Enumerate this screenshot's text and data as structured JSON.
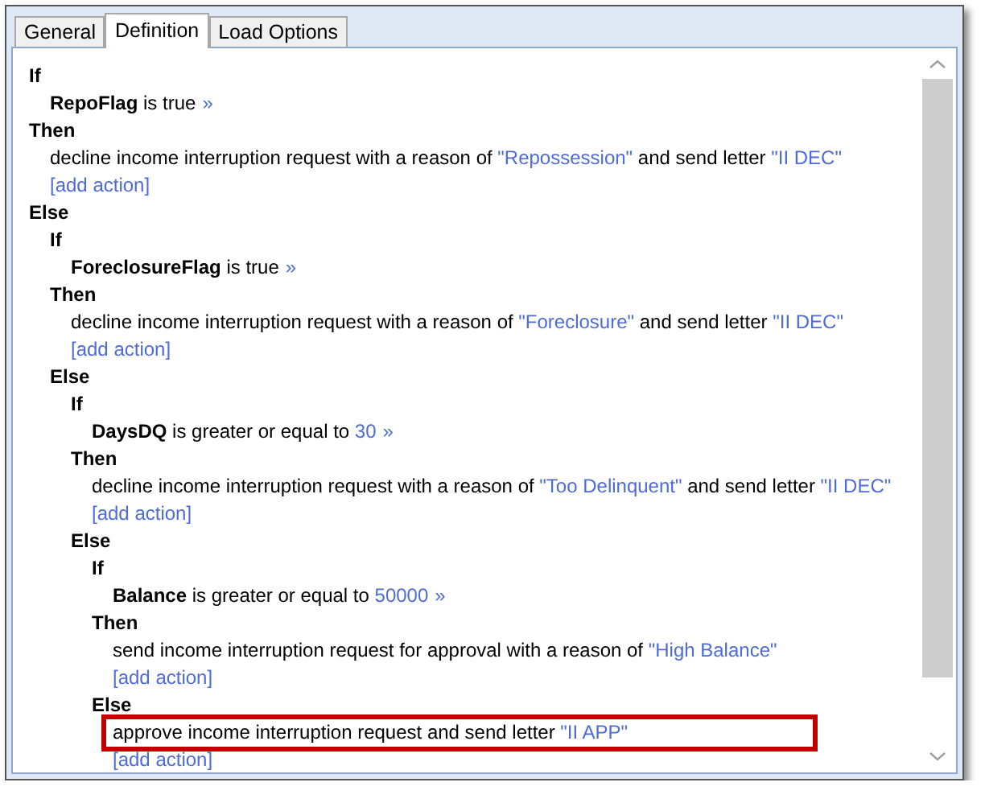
{
  "tabs": [
    {
      "label": "General",
      "selected": false
    },
    {
      "label": "Definition",
      "selected": true
    },
    {
      "label": "Load Options",
      "selected": false
    }
  ],
  "rules": [
    {
      "kind": "keyword",
      "text": "If",
      "children": [
        {
          "kind": "condition",
          "parts": [
            {
              "kind": "field",
              "text": "RepoFlag"
            },
            {
              "kind": "plain",
              "text": " is true"
            }
          ],
          "more": "»"
        }
      ]
    },
    {
      "kind": "keyword",
      "text": "Then",
      "children": [
        {
          "kind": "action",
          "highlighted": false,
          "parts": [
            {
              "kind": "plain",
              "text": "decline income interruption request with a reason of "
            },
            {
              "kind": "value",
              "text": "\"Repossession\""
            },
            {
              "kind": "plain",
              "text": " and send letter "
            },
            {
              "kind": "value",
              "text": "\"II DEC\""
            }
          ]
        },
        {
          "kind": "link",
          "text": "[add action]"
        }
      ]
    },
    {
      "kind": "keyword",
      "text": "Else",
      "children": [
        {
          "kind": "keyword",
          "text": "If",
          "children": [
            {
              "kind": "condition",
              "parts": [
                {
                  "kind": "field",
                  "text": "ForeclosureFlag"
                },
                {
                  "kind": "plain",
                  "text": " is true"
                }
              ],
              "more": "»"
            }
          ]
        },
        {
          "kind": "keyword",
          "text": "Then",
          "children": [
            {
              "kind": "action",
              "highlighted": false,
              "parts": [
                {
                  "kind": "plain",
                  "text": "decline income interruption request with a reason of "
                },
                {
                  "kind": "value",
                  "text": "\"Foreclosure\""
                },
                {
                  "kind": "plain",
                  "text": " and send letter "
                },
                {
                  "kind": "value",
                  "text": "\"II DEC\""
                }
              ]
            },
            {
              "kind": "link",
              "text": "[add action]"
            }
          ]
        },
        {
          "kind": "keyword",
          "text": "Else",
          "children": [
            {
              "kind": "keyword",
              "text": "If",
              "children": [
                {
                  "kind": "condition",
                  "parts": [
                    {
                      "kind": "field",
                      "text": "DaysDQ"
                    },
                    {
                      "kind": "plain",
                      "text": " is greater or equal to "
                    },
                    {
                      "kind": "value",
                      "text": "30"
                    }
                  ],
                  "more": "»"
                }
              ]
            },
            {
              "kind": "keyword",
              "text": "Then",
              "children": [
                {
                  "kind": "action",
                  "highlighted": false,
                  "parts": [
                    {
                      "kind": "plain",
                      "text": "decline income interruption request with a reason of "
                    },
                    {
                      "kind": "value",
                      "text": "\"Too Delinquent\""
                    },
                    {
                      "kind": "plain",
                      "text": " and send letter "
                    },
                    {
                      "kind": "value",
                      "text": "\"II DEC\""
                    }
                  ]
                },
                {
                  "kind": "link",
                  "text": "[add action]"
                }
              ]
            },
            {
              "kind": "keyword",
              "text": "Else",
              "children": [
                {
                  "kind": "keyword",
                  "text": "If",
                  "children": [
                    {
                      "kind": "condition",
                      "parts": [
                        {
                          "kind": "field",
                          "text": "Balance"
                        },
                        {
                          "kind": "plain",
                          "text": " is greater or equal to "
                        },
                        {
                          "kind": "value",
                          "text": "50000"
                        }
                      ],
                      "more": "»"
                    }
                  ]
                },
                {
                  "kind": "keyword",
                  "text": "Then",
                  "children": [
                    {
                      "kind": "action",
                      "highlighted": false,
                      "parts": [
                        {
                          "kind": "plain",
                          "text": "send income interruption request for approval with a reason of "
                        },
                        {
                          "kind": "value",
                          "text": "\"High Balance\""
                        }
                      ]
                    },
                    {
                      "kind": "link",
                      "text": "[add action]"
                    }
                  ]
                },
                {
                  "kind": "keyword",
                  "text": "Else",
                  "children": [
                    {
                      "kind": "action",
                      "highlighted": true,
                      "parts": [
                        {
                          "kind": "plain",
                          "text": "approve income interruption request and send letter "
                        },
                        {
                          "kind": "value",
                          "text": "\"II APP\""
                        }
                      ]
                    },
                    {
                      "kind": "link",
                      "text": "[add action]"
                    }
                  ]
                }
              ]
            }
          ]
        }
      ]
    }
  ]
}
